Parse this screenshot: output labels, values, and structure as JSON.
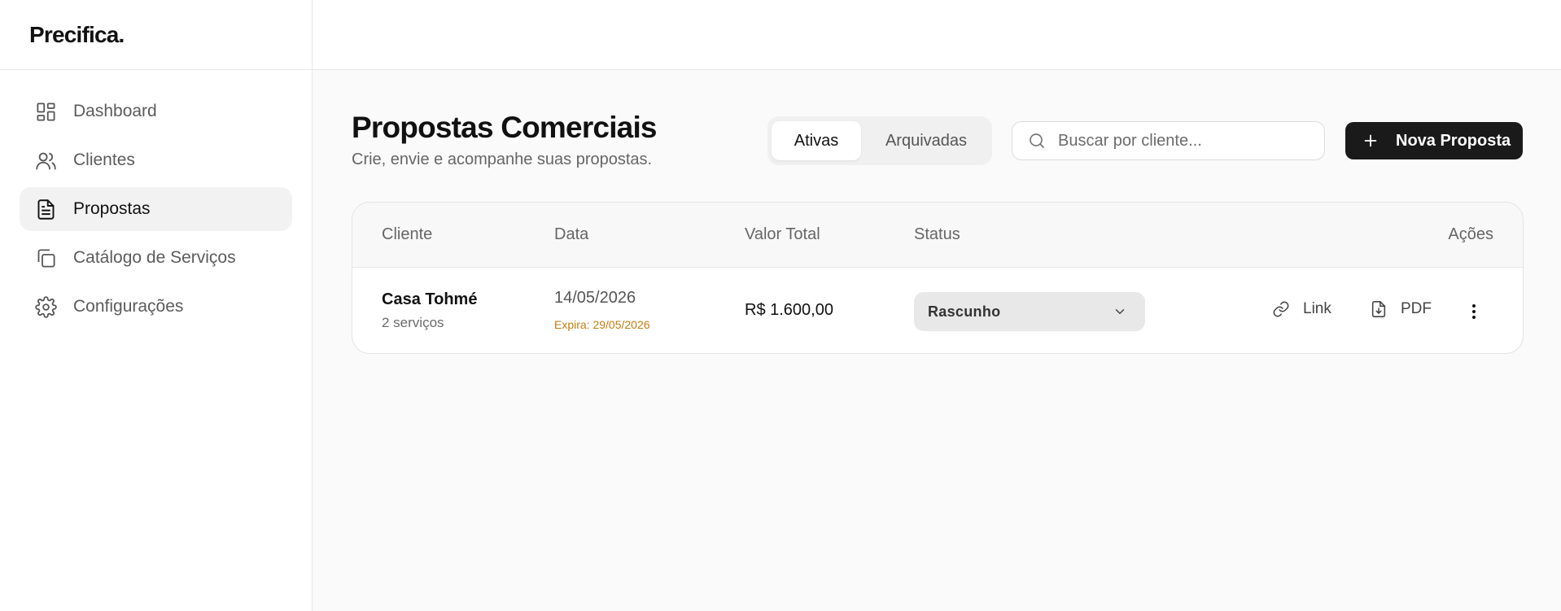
{
  "app": {
    "logo": "Precifica."
  },
  "sidebar": {
    "items": [
      {
        "label": "Dashboard",
        "icon": "dashboard-icon"
      },
      {
        "label": "Clientes",
        "icon": "users-icon"
      },
      {
        "label": "Propostas",
        "icon": "document-icon"
      },
      {
        "label": "Catálogo de Serviços",
        "icon": "copy-icon"
      },
      {
        "label": "Configurações",
        "icon": "gear-icon"
      }
    ],
    "active": "Propostas"
  },
  "page": {
    "title": "Propostas Comerciais",
    "subtitle": "Crie, envie e acompanhe suas propostas."
  },
  "tabs": [
    {
      "label": "Ativas",
      "active": true
    },
    {
      "label": "Arquivadas",
      "active": false
    }
  ],
  "search": {
    "placeholder": "Buscar por cliente...",
    "value": ""
  },
  "new_button": {
    "label": "Nova Proposta"
  },
  "table": {
    "headers": [
      "Cliente",
      "Data",
      "Valor Total",
      "Status",
      "Ações"
    ],
    "rows": [
      {
        "client": "Casa Tohmé",
        "services": "2 serviços",
        "date": "14/05/2026",
        "expires": "Expira: 29/05/2026",
        "total": "R$ 1.600,00",
        "status": "Rascunho",
        "actions": {
          "link": "Link",
          "pdf": "PDF"
        }
      }
    ]
  },
  "colors": {
    "accent": "#1a1a1a",
    "expires": "#c27c0e",
    "active_nav_bg": "#f2f2f2"
  }
}
